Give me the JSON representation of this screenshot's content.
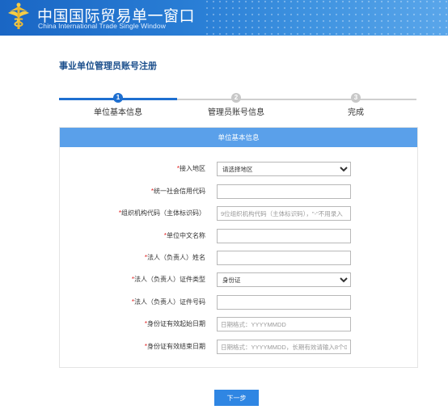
{
  "header": {
    "brand_cn": "中国国际贸易单一窗口",
    "brand_en": "China International Trade Single Window",
    "logo_icon": "customs-emblem-icon",
    "bg_color": "#1f70cc"
  },
  "page": {
    "title": "事业单位管理员账号注册"
  },
  "steps": [
    {
      "num": "1",
      "label": "单位基本信息",
      "active": true
    },
    {
      "num": "2",
      "label": "管理员账号信息",
      "active": false
    },
    {
      "num": "3",
      "label": "完成",
      "active": false
    }
  ],
  "form": {
    "panel_title": "单位基本信息",
    "fields": [
      {
        "label": "接入地区",
        "type": "select",
        "value": "请选择地区"
      },
      {
        "label": "统一社会信用代码",
        "type": "input",
        "placeholder": ""
      },
      {
        "label": "组织机构代码（主体标识码）",
        "type": "input",
        "placeholder": "9位组织机构代码（主体标识码），\"-\"不用录入"
      },
      {
        "label": "单位中文名称",
        "type": "input",
        "placeholder": ""
      },
      {
        "label": "法人（负责人）姓名",
        "type": "input",
        "placeholder": ""
      },
      {
        "label": "法人（负责人）证件类型",
        "type": "select",
        "value": "身份证"
      },
      {
        "label": "法人（负责人）证件号码",
        "type": "input",
        "placeholder": ""
      },
      {
        "label": "身份证有效起始日期",
        "type": "input",
        "placeholder": "日期格式：YYYYMMDD"
      },
      {
        "label": "身份证有效结束日期",
        "type": "input",
        "placeholder": "日期格式：YYYYMMDD，长期有效请输入8个0"
      }
    ],
    "required_mark": "*"
  },
  "actions": {
    "next_label": "下一步"
  },
  "colors": {
    "accent": "#1e6fd0",
    "panel_head": "#5aa0ea",
    "required": "#e02020",
    "button": "#2f86e3"
  }
}
